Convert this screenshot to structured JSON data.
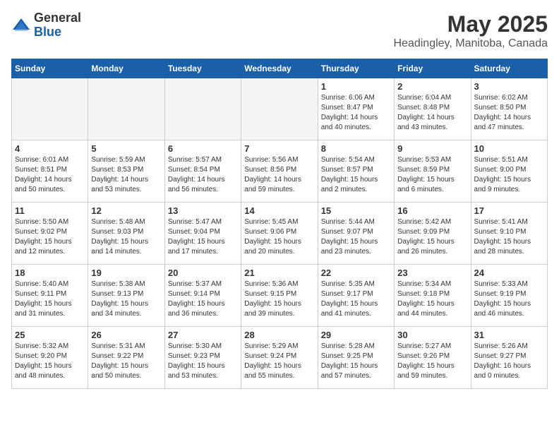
{
  "header": {
    "logo_general": "General",
    "logo_blue": "Blue",
    "title": "May 2025",
    "location": "Headingley, Manitoba, Canada"
  },
  "days_of_week": [
    "Sunday",
    "Monday",
    "Tuesday",
    "Wednesday",
    "Thursday",
    "Friday",
    "Saturday"
  ],
  "weeks": [
    [
      {
        "day": "",
        "empty": true
      },
      {
        "day": "",
        "empty": true
      },
      {
        "day": "",
        "empty": true
      },
      {
        "day": "",
        "empty": true
      },
      {
        "day": "1",
        "line1": "Sunrise: 6:06 AM",
        "line2": "Sunset: 8:47 PM",
        "line3": "Daylight: 14 hours",
        "line4": "and 40 minutes."
      },
      {
        "day": "2",
        "line1": "Sunrise: 6:04 AM",
        "line2": "Sunset: 8:48 PM",
        "line3": "Daylight: 14 hours",
        "line4": "and 43 minutes."
      },
      {
        "day": "3",
        "line1": "Sunrise: 6:02 AM",
        "line2": "Sunset: 8:50 PM",
        "line3": "Daylight: 14 hours",
        "line4": "and 47 minutes."
      }
    ],
    [
      {
        "day": "4",
        "line1": "Sunrise: 6:01 AM",
        "line2": "Sunset: 8:51 PM",
        "line3": "Daylight: 14 hours",
        "line4": "and 50 minutes."
      },
      {
        "day": "5",
        "line1": "Sunrise: 5:59 AM",
        "line2": "Sunset: 8:53 PM",
        "line3": "Daylight: 14 hours",
        "line4": "and 53 minutes."
      },
      {
        "day": "6",
        "line1": "Sunrise: 5:57 AM",
        "line2": "Sunset: 8:54 PM",
        "line3": "Daylight: 14 hours",
        "line4": "and 56 minutes."
      },
      {
        "day": "7",
        "line1": "Sunrise: 5:56 AM",
        "line2": "Sunset: 8:56 PM",
        "line3": "Daylight: 14 hours",
        "line4": "and 59 minutes."
      },
      {
        "day": "8",
        "line1": "Sunrise: 5:54 AM",
        "line2": "Sunset: 8:57 PM",
        "line3": "Daylight: 15 hours",
        "line4": "and 2 minutes."
      },
      {
        "day": "9",
        "line1": "Sunrise: 5:53 AM",
        "line2": "Sunset: 8:59 PM",
        "line3": "Daylight: 15 hours",
        "line4": "and 6 minutes."
      },
      {
        "day": "10",
        "line1": "Sunrise: 5:51 AM",
        "line2": "Sunset: 9:00 PM",
        "line3": "Daylight: 15 hours",
        "line4": "and 9 minutes."
      }
    ],
    [
      {
        "day": "11",
        "line1": "Sunrise: 5:50 AM",
        "line2": "Sunset: 9:02 PM",
        "line3": "Daylight: 15 hours",
        "line4": "and 12 minutes."
      },
      {
        "day": "12",
        "line1": "Sunrise: 5:48 AM",
        "line2": "Sunset: 9:03 PM",
        "line3": "Daylight: 15 hours",
        "line4": "and 14 minutes."
      },
      {
        "day": "13",
        "line1": "Sunrise: 5:47 AM",
        "line2": "Sunset: 9:04 PM",
        "line3": "Daylight: 15 hours",
        "line4": "and 17 minutes."
      },
      {
        "day": "14",
        "line1": "Sunrise: 5:45 AM",
        "line2": "Sunset: 9:06 PM",
        "line3": "Daylight: 15 hours",
        "line4": "and 20 minutes."
      },
      {
        "day": "15",
        "line1": "Sunrise: 5:44 AM",
        "line2": "Sunset: 9:07 PM",
        "line3": "Daylight: 15 hours",
        "line4": "and 23 minutes."
      },
      {
        "day": "16",
        "line1": "Sunrise: 5:42 AM",
        "line2": "Sunset: 9:09 PM",
        "line3": "Daylight: 15 hours",
        "line4": "and 26 minutes."
      },
      {
        "day": "17",
        "line1": "Sunrise: 5:41 AM",
        "line2": "Sunset: 9:10 PM",
        "line3": "Daylight: 15 hours",
        "line4": "and 28 minutes."
      }
    ],
    [
      {
        "day": "18",
        "line1": "Sunrise: 5:40 AM",
        "line2": "Sunset: 9:11 PM",
        "line3": "Daylight: 15 hours",
        "line4": "and 31 minutes."
      },
      {
        "day": "19",
        "line1": "Sunrise: 5:38 AM",
        "line2": "Sunset: 9:13 PM",
        "line3": "Daylight: 15 hours",
        "line4": "and 34 minutes."
      },
      {
        "day": "20",
        "line1": "Sunrise: 5:37 AM",
        "line2": "Sunset: 9:14 PM",
        "line3": "Daylight: 15 hours",
        "line4": "and 36 minutes."
      },
      {
        "day": "21",
        "line1": "Sunrise: 5:36 AM",
        "line2": "Sunset: 9:15 PM",
        "line3": "Daylight: 15 hours",
        "line4": "and 39 minutes."
      },
      {
        "day": "22",
        "line1": "Sunrise: 5:35 AM",
        "line2": "Sunset: 9:17 PM",
        "line3": "Daylight: 15 hours",
        "line4": "and 41 minutes."
      },
      {
        "day": "23",
        "line1": "Sunrise: 5:34 AM",
        "line2": "Sunset: 9:18 PM",
        "line3": "Daylight: 15 hours",
        "line4": "and 44 minutes."
      },
      {
        "day": "24",
        "line1": "Sunrise: 5:33 AM",
        "line2": "Sunset: 9:19 PM",
        "line3": "Daylight: 15 hours",
        "line4": "and 46 minutes."
      }
    ],
    [
      {
        "day": "25",
        "line1": "Sunrise: 5:32 AM",
        "line2": "Sunset: 9:20 PM",
        "line3": "Daylight: 15 hours",
        "line4": "and 48 minutes."
      },
      {
        "day": "26",
        "line1": "Sunrise: 5:31 AM",
        "line2": "Sunset: 9:22 PM",
        "line3": "Daylight: 15 hours",
        "line4": "and 50 minutes."
      },
      {
        "day": "27",
        "line1": "Sunrise: 5:30 AM",
        "line2": "Sunset: 9:23 PM",
        "line3": "Daylight: 15 hours",
        "line4": "and 53 minutes."
      },
      {
        "day": "28",
        "line1": "Sunrise: 5:29 AM",
        "line2": "Sunset: 9:24 PM",
        "line3": "Daylight: 15 hours",
        "line4": "and 55 minutes."
      },
      {
        "day": "29",
        "line1": "Sunrise: 5:28 AM",
        "line2": "Sunset: 9:25 PM",
        "line3": "Daylight: 15 hours",
        "line4": "and 57 minutes."
      },
      {
        "day": "30",
        "line1": "Sunrise: 5:27 AM",
        "line2": "Sunset: 9:26 PM",
        "line3": "Daylight: 15 hours",
        "line4": "and 59 minutes."
      },
      {
        "day": "31",
        "line1": "Sunrise: 5:26 AM",
        "line2": "Sunset: 9:27 PM",
        "line3": "Daylight: 16 hours",
        "line4": "and 0 minutes."
      }
    ]
  ]
}
